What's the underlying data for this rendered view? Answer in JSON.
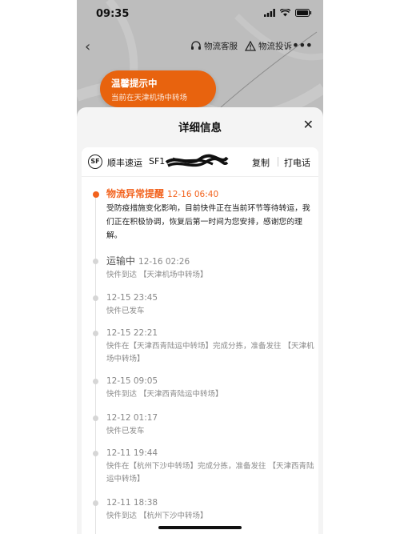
{
  "status_bar": {
    "time": "09:35"
  },
  "nav": {
    "customer_service": "物流客服",
    "complaint": "物流投诉"
  },
  "hint_banner": {
    "title": "温馨提示中",
    "subtitle": "当前在天津机场中转场"
  },
  "sheet": {
    "title": "详细信息",
    "carrier": "顺丰速运",
    "waybill_prefix": "SF1",
    "copy_label": "复制",
    "call_label": "打电话",
    "logo_text": "SF"
  },
  "events": [
    {
      "status": "物流异常提醒",
      "time": "12-16 06:40",
      "desc": "受防疫措施变化影响，目前快件正在当前环节等待转运，我们正在积极协调，恢复后第一时间为您安排，感谢您的理解。"
    },
    {
      "status": "运输中",
      "time": "12-16 02:26",
      "desc": "快件到达 【天津机场中转场】"
    },
    {
      "status": "",
      "time": "12-15 23:45",
      "desc": "快件已发车"
    },
    {
      "status": "",
      "time": "12-15 22:21",
      "desc": "快件在【天津西青陆运中转场】完成分拣，准备发往 【天津机场中转场】"
    },
    {
      "status": "",
      "time": "12-15 09:05",
      "desc": "快件到达 【天津西青陆运中转场】"
    },
    {
      "status": "",
      "time": "12-12 01:17",
      "desc": "快件已发车"
    },
    {
      "status": "",
      "time": "12-11 19:44",
      "desc": "快件在【杭州下沙中转场】完成分拣，准备发往 【天津西青陆运中转场】"
    },
    {
      "status": "",
      "time": "12-11 18:38",
      "desc": "快件到达 【杭州下沙中转场】"
    }
  ],
  "colors": {
    "accent": "#f2621d",
    "hint_bg": "#e8630e"
  }
}
